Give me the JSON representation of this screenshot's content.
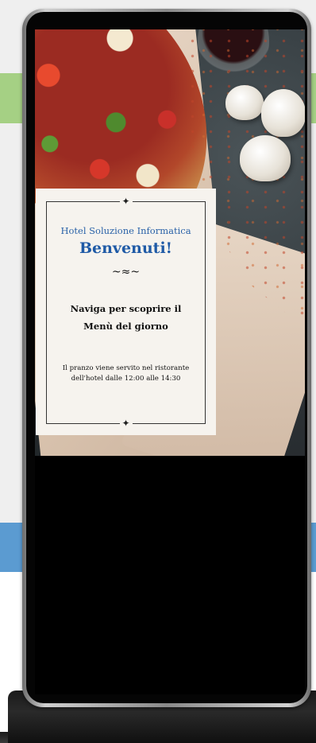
{
  "page": {
    "colors": {
      "band_green": "#a5d084",
      "band_blue": "#5b9bd1",
      "title_blue": "#1f5aa6"
    }
  },
  "card": {
    "hotel_name": "Hotel Soluzione Informatica",
    "title": "Benvenuti!",
    "flourish_glyph": "~≈~",
    "nav_prompt_line1": "Naviga per scoprire il",
    "nav_prompt_line2": "Menù del giorno",
    "info_line1": "Il pranzo viene servito nel ristorante",
    "info_line2": "dell'hotel dalle 12:00 alle 14:30",
    "ornament_glyph": "✦"
  }
}
